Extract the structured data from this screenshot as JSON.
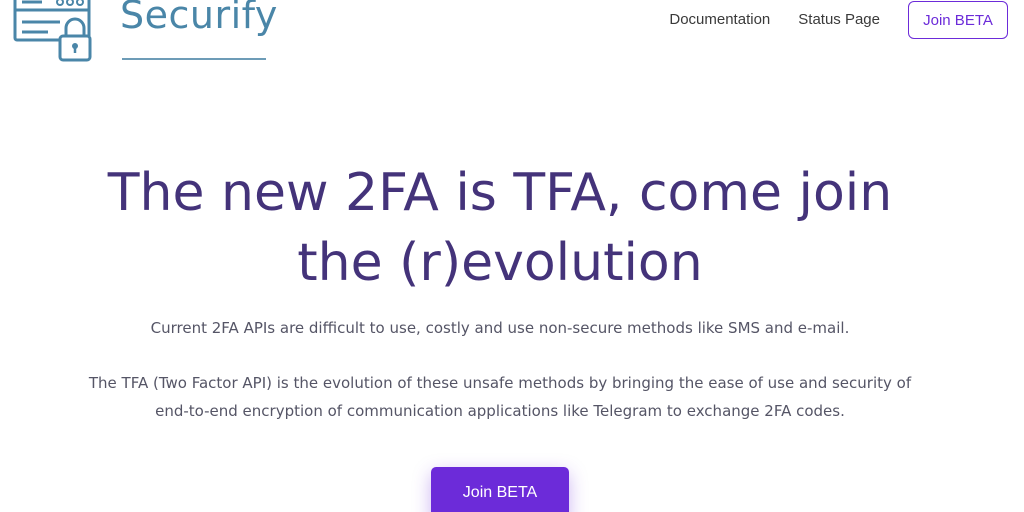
{
  "brand": {
    "name": "Securify",
    "logo_icon": "server-lock-icon",
    "color": "#4a86a8"
  },
  "nav": {
    "links": [
      "Documentation",
      "Status Page"
    ],
    "join_label": "Join BETA",
    "accent": "#6c2bd9"
  },
  "hero": {
    "title_line1": "The new 2FA is TFA, come join",
    "title_line2": "the (r)evolution",
    "title_color": "#44337a",
    "paragraph1": "Current 2FA APIs are difficult to use, costly and use non-secure methods like SMS and e-mail.",
    "paragraph2_line1": "The TFA (Two Factor API) is the evolution of these unsafe methods by bringing the ease of use and security of",
    "paragraph2_line2": "end-to-end encryption of communication applications like Telegram to exchange 2FA codes.",
    "cta_label": "Join BETA"
  }
}
